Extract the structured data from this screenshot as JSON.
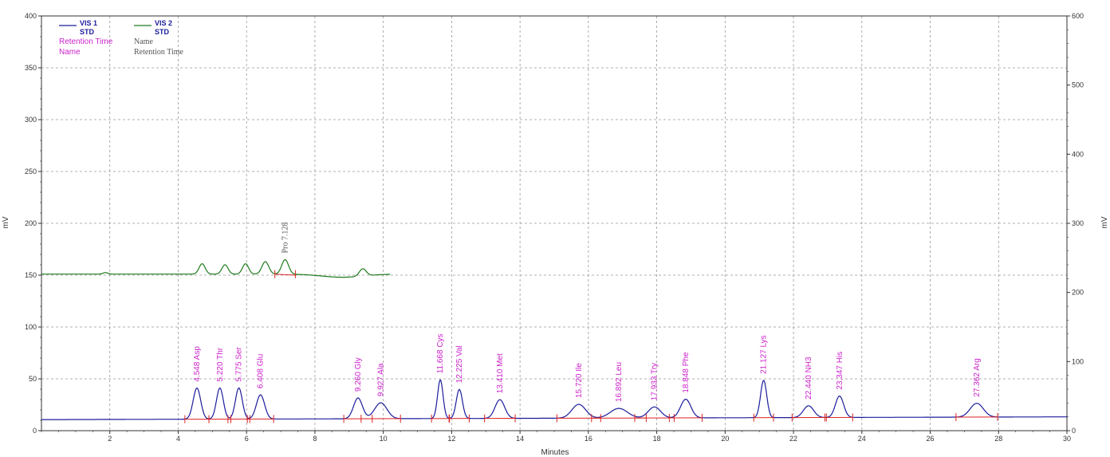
{
  "colors": {
    "vis1": "#1c1c9c",
    "vis2": "#1d7a1d",
    "baseline": "#dd2222",
    "label_vis1": "#cc22cc",
    "label_vis2": "#555555",
    "grid": "#999999",
    "axis": "#333333"
  },
  "legend": {
    "series": [
      {
        "name": "VIS 1",
        "sub": "STD"
      },
      {
        "name": "VIS 2",
        "sub": "STD"
      }
    ],
    "fields": [
      [
        "Retention Time",
        "Name"
      ],
      [
        "Name",
        "Retention Time"
      ]
    ]
  },
  "chart_data": {
    "type": "line",
    "xlabel": "Minutes",
    "ylabel": "mV",
    "y2label": "mV",
    "xlim": [
      0,
      30
    ],
    "ylim": [
      0,
      400
    ],
    "y2lim": [
      0,
      600
    ],
    "x_ticks": [
      2,
      4,
      6,
      8,
      10,
      12,
      14,
      16,
      18,
      20,
      22,
      24,
      26,
      28,
      30
    ],
    "y_ticks": [
      0,
      50,
      100,
      150,
      200,
      250,
      300,
      350,
      400
    ],
    "y2_ticks": [
      0,
      100,
      200,
      300,
      400,
      500,
      600
    ],
    "grid": true,
    "legend_position": "top-left",
    "series": [
      {
        "name": "VIS 1",
        "axis": "right",
        "baseline_start": 16,
        "baseline_end": 20,
        "peaks": [
          {
            "rt": 4.548,
            "name": "Asp",
            "height": 45,
            "width": 0.11
          },
          {
            "rt": 5.22,
            "name": "Thr",
            "height": 45,
            "width": 0.1
          },
          {
            "rt": 5.775,
            "name": "Ser",
            "height": 45,
            "width": 0.1
          },
          {
            "rt": 6.408,
            "name": "Glu",
            "height": 35,
            "width": 0.12
          },
          {
            "rt": 9.26,
            "name": "Gly",
            "height": 30,
            "width": 0.13
          },
          {
            "rt": 9.927,
            "name": "Ala",
            "height": 23,
            "width": 0.18
          },
          {
            "rt": 11.668,
            "name": "Cys",
            "height": 56,
            "width": 0.08
          },
          {
            "rt": 12.225,
            "name": "Val",
            "height": 42,
            "width": 0.09
          },
          {
            "rt": 13.41,
            "name": "Met",
            "height": 27,
            "width": 0.14
          },
          {
            "rt": 15.72,
            "name": "Ile",
            "height": 20,
            "width": 0.2
          },
          {
            "rt": 16.892,
            "name": "Leu",
            "height": 14,
            "width": 0.25
          },
          {
            "rt": 17.933,
            "name": "Try",
            "height": 16,
            "width": 0.18
          },
          {
            "rt": 18.848,
            "name": "Phe",
            "height": 27,
            "width": 0.15
          },
          {
            "rt": 21.127,
            "name": "Lys",
            "height": 54,
            "width": 0.09
          },
          {
            "rt": 22.44,
            "name": "NH3",
            "height": 17,
            "width": 0.15
          },
          {
            "rt": 23.347,
            "name": "His",
            "height": 31,
            "width": 0.12
          },
          {
            "rt": 27.362,
            "name": "Arg",
            "height": 20,
            "width": 0.19
          }
        ]
      },
      {
        "name": "VIS 2",
        "axis": "left",
        "x_range": [
          0,
          10.2
        ],
        "baseline": 151,
        "dips": [
          {
            "x": 8.8,
            "depth": 3,
            "width": 0.6
          }
        ],
        "peaks": [
          {
            "rt": 1.87,
            "height": 1.5,
            "width": 0.07,
            "name": ""
          },
          {
            "rt": 4.7,
            "height": 10,
            "width": 0.09,
            "name": ""
          },
          {
            "rt": 5.37,
            "height": 9,
            "width": 0.09,
            "name": ""
          },
          {
            "rt": 5.97,
            "height": 10,
            "width": 0.09,
            "name": ""
          },
          {
            "rt": 6.55,
            "height": 12,
            "width": 0.1,
            "name": ""
          },
          {
            "rt": 7.128,
            "height": 14,
            "width": 0.1,
            "name": "Pro"
          },
          {
            "rt": 9.4,
            "height": 7,
            "width": 0.1,
            "name": ""
          }
        ],
        "labeled_peak": {
          "rt": 7.128,
          "name": "Pro",
          "rt_label": "7.128"
        }
      }
    ]
  }
}
